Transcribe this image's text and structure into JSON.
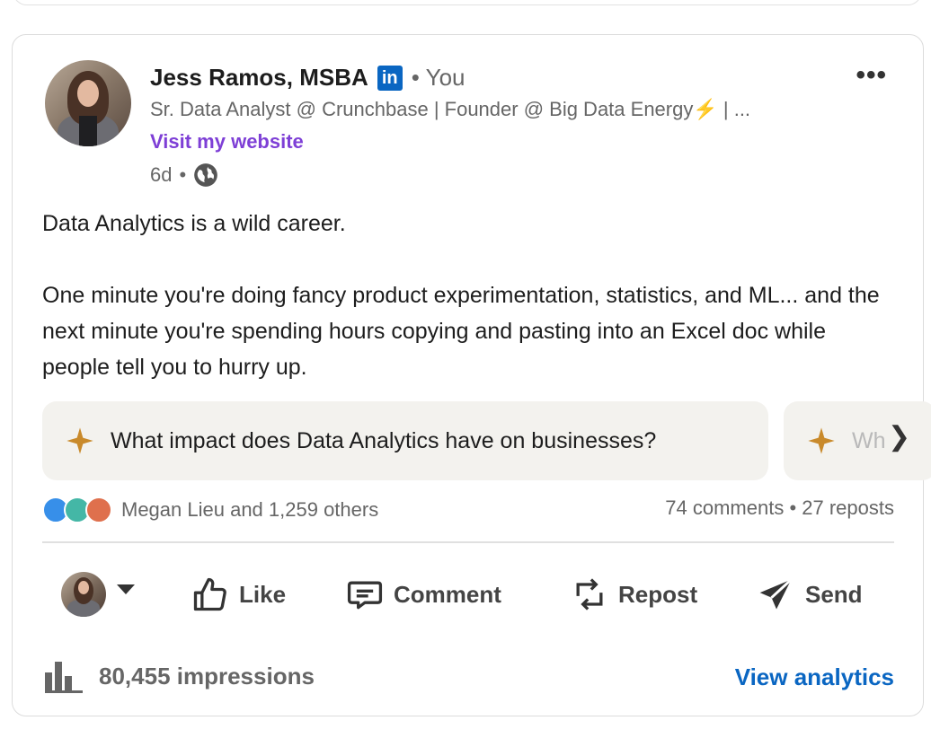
{
  "post": {
    "author_name": "Jess Ramos, MSBA",
    "linkedin_badge": "in",
    "relation": "• You",
    "headline_text": "Sr. Data Analyst @ Crunchbase | Founder @ Big Data Energy",
    "headline_bolt": "⚡",
    "headline_tail": " | ...",
    "website_link": "Visit my website",
    "age": "6d",
    "age_sep": "•",
    "more_menu": "•••",
    "body_line1": "Data Analytics is a wild career.",
    "body_line2": "One minute you're doing fancy product experimentation, statistics, and ML... and the next minute you're spending hours copying and pasting into an Excel doc while people tell you to hurry up."
  },
  "suggestions": [
    {
      "text": "What impact does Data Analytics have on businesses?"
    },
    {
      "text": "Wh"
    }
  ],
  "suggestions_next": "❯",
  "social": {
    "reactions_text": "Megan Lieu and 1,259 others",
    "comments": "74 comments",
    "sep": " • ",
    "reposts": "27 reposts"
  },
  "actions": {
    "like": "Like",
    "comment": "Comment",
    "repost": "Repost",
    "send": "Send"
  },
  "footer": {
    "impressions": "80,455 impressions",
    "view_analytics": "View analytics"
  },
  "colors": {
    "linkedin_blue": "#0a66c2",
    "website_purple": "#7e3fd6",
    "sparkle_gold": "#c98a2b"
  },
  "icons": [
    "linkedin-icon",
    "globe-icon",
    "sparkle-icon",
    "like-icon",
    "comment-icon",
    "repost-icon",
    "send-icon",
    "bar-chart-icon"
  ]
}
